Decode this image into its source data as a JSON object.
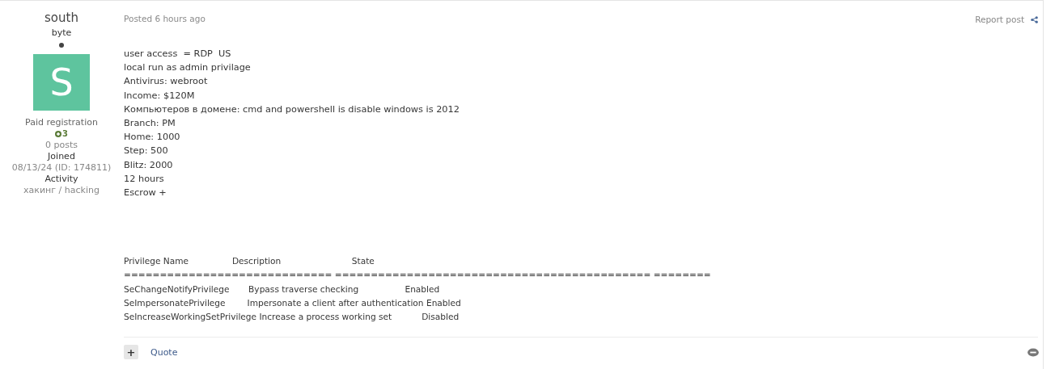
{
  "author": {
    "name": "south",
    "rank": "byte",
    "avatar_letter": "S",
    "group": "Paid registration",
    "reputation": "3",
    "posts": "0 posts",
    "joined_label": "Joined",
    "joined_value": "08/13/24 (ID: 174811)",
    "activity_label": "Activity",
    "activity_value": "хакинг / hacking"
  },
  "post": {
    "posted": "Posted 6 hours ago",
    "report": "Report post",
    "lines": [
      "user access  = RDP  US",
      "local run as admin privilage",
      "Antivirus: webroot",
      "Income: $120M",
      "Компьютеров в домене: cmd and powershell is disable windows is 2012",
      "Branch: PM",
      "Home: 1000",
      "Step: 500",
      "Blitz: 2000",
      "12 hours",
      "Escrow +"
    ],
    "table_lines": [
      "Privilege Name                Description                          State",
      "============================= ============================================ ========",
      "SeChangeNotifyPrivilege       Bypass traverse checking                 Enabled",
      "SeImpersonatePrivilege        Impersonate a client after authentication Enabled",
      "SeIncreaseWorkingSetPrivilege Increase a process working set           Disabled"
    ]
  },
  "footer": {
    "plus": "+",
    "quote": "Quote"
  }
}
